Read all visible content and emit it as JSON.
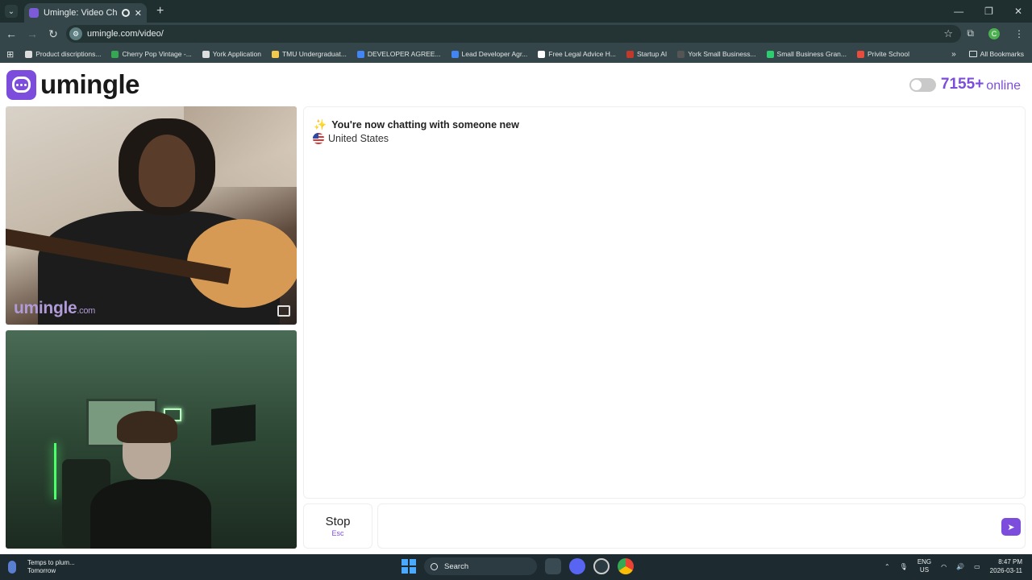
{
  "browser": {
    "tab_title": "Umingle: Video Chat with S",
    "tab_close": "✕",
    "new_tab": "+",
    "url": "umingle.com/video/",
    "window_controls": [
      "—",
      "❐",
      "✕"
    ],
    "bookmarks": [
      {
        "label": "Product discriptions...",
        "color": "#dddddd"
      },
      {
        "label": "Cherry Pop Vintage -...",
        "color": "#34a853"
      },
      {
        "label": "York Application",
        "color": "#dddddd"
      },
      {
        "label": "TMU Undergraduat...",
        "color": "#f2c94c"
      },
      {
        "label": "DEVELOPER AGREE...",
        "color": "#4285f4"
      },
      {
        "label": "Lead Developer Agr...",
        "color": "#4285f4"
      },
      {
        "label": "Free Legal Advice H...",
        "color": "#ffffff"
      },
      {
        "label": "Startup AI",
        "color": "#c0392b"
      },
      {
        "label": "York Small Business...",
        "color": "#555555"
      },
      {
        "label": "Small Business Gran...",
        "color": "#2ecc71"
      },
      {
        "label": "Privite School",
        "color": "#e74c3c"
      }
    ],
    "bookmarks_more": "»",
    "all_bookmarks": "All Bookmarks"
  },
  "header": {
    "logo_text": "umingle",
    "online_count": "7155+",
    "online_label": "online"
  },
  "videos": {
    "watermark": "umingle",
    "watermark_suffix": ".com"
  },
  "chat": {
    "status_message": "You're now chatting with someone new",
    "status_icon": "✨",
    "country": "United States"
  },
  "controls": {
    "stop_label": "Stop",
    "stop_key": "Esc",
    "message_placeholder": "",
    "send_icon": "➤"
  },
  "taskbar": {
    "weather_line1": "Temps to plum...",
    "weather_line2": "Tomorrow",
    "search_label": "Search",
    "lang_line1": "ENG",
    "lang_line2": "US",
    "time": "8:47 PM",
    "date": "2026-03-11"
  },
  "colors": {
    "brand": "#7c4ddc"
  }
}
